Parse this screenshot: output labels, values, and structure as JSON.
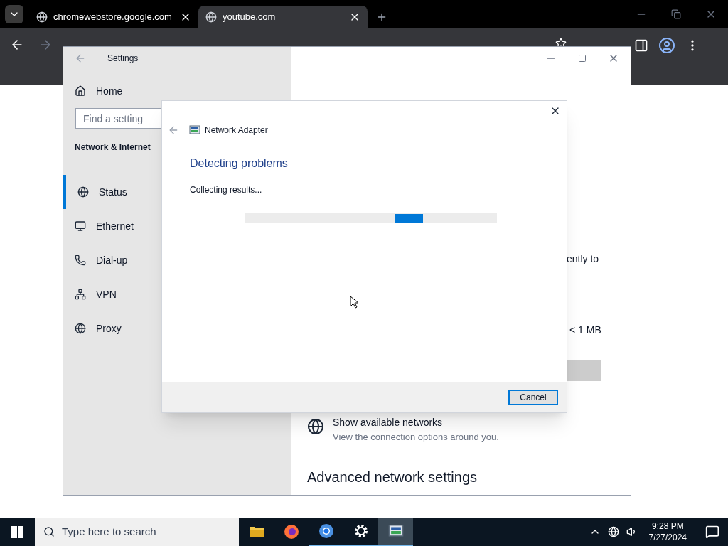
{
  "browser": {
    "tabs": [
      {
        "title": "chromewebstore.google.com",
        "selected": false
      },
      {
        "title": "youtube.com",
        "selected": true
      }
    ]
  },
  "settings": {
    "title": "Settings",
    "home": "Home",
    "search": {
      "placeholder": "Find a setting"
    },
    "section": "Network & Internet",
    "nav": [
      {
        "label": "Status",
        "kind": "status",
        "selected": true
      },
      {
        "label": "Ethernet",
        "kind": "ethernet",
        "selected": false
      },
      {
        "label": "Dial-up",
        "kind": "dialup",
        "selected": false
      },
      {
        "label": "VPN",
        "kind": "vpn",
        "selected": false
      },
      {
        "label": "Proxy",
        "kind": "proxy",
        "selected": false
      }
    ],
    "fragment_1": "ently to",
    "fragment_2": "< 1 MB",
    "networks": {
      "title": "Show available networks",
      "subtitle": "View the connection options around you."
    },
    "advanced": "Advanced network settings"
  },
  "dialog": {
    "title": "Network Adapter",
    "heading": "Detecting problems",
    "status": "Collecting results...",
    "cancel": "Cancel"
  },
  "taskbar": {
    "search": {
      "placeholder": "Type here to search"
    },
    "apps": [
      {
        "kind": "folder",
        "open": false,
        "selected": false
      },
      {
        "kind": "firefox",
        "open": false,
        "selected": false
      },
      {
        "kind": "chrome",
        "open": true,
        "selected": false
      },
      {
        "kind": "gear",
        "open": true,
        "selected": false
      },
      {
        "kind": "adapter",
        "open": true,
        "selected": true
      }
    ],
    "time": "9:28 PM",
    "date": "7/27/2024"
  }
}
